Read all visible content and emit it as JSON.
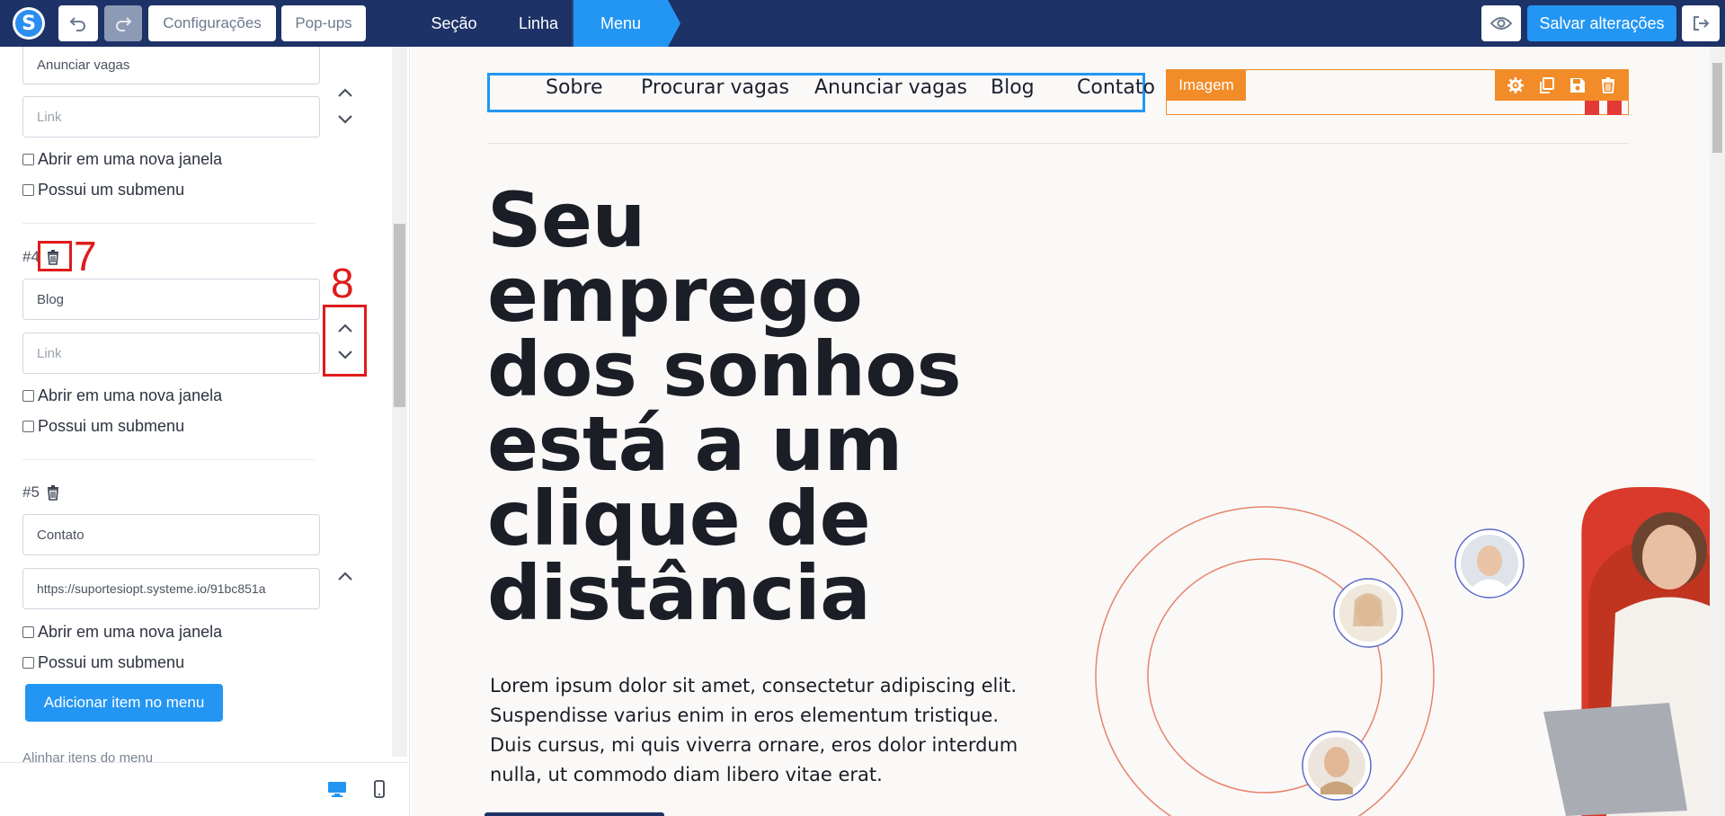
{
  "toolbar": {
    "logo_letter": "S",
    "settings_label": "Configurações",
    "popups_label": "Pop-ups",
    "tabs": [
      {
        "label": "Seção"
      },
      {
        "label": "Linha"
      },
      {
        "label": "Menu"
      }
    ],
    "save_label": "Salvar alterações"
  },
  "sidebar": {
    "item3": {
      "name_value": "Anunciar vagas",
      "link_placeholder": "Link",
      "new_window_label": "Abrir em uma nova janela",
      "submenu_label": "Possui um submenu"
    },
    "item4": {
      "number": "#4",
      "name_value": "Blog",
      "link_placeholder": "Link",
      "new_window_label": "Abrir em uma nova janela",
      "submenu_label": "Possui um submenu"
    },
    "item5": {
      "number": "#5",
      "name_value": "Contato",
      "link_value": "https://suportesiopt.systeme.io/91bc851a",
      "new_window_label": "Abrir em uma nova janela",
      "submenu_label": "Possui um submenu"
    },
    "add_item_label": "Adicionar item no menu",
    "align_label": "Alinhar itens do menu"
  },
  "annotations": {
    "label_7": "7",
    "label_8": "8",
    "color": "#e01b1b"
  },
  "preview": {
    "nav_links": [
      "Sobre",
      "Procurar vagas",
      "Anunciar vagas",
      "Blog",
      "Contato"
    ],
    "image_tag": "Imagem",
    "hero_lines": [
      "Seu emprego",
      "dos sonhos",
      "está a um",
      "clique de",
      "distância"
    ],
    "lorem_lines": [
      "Lorem ipsum dolor sit amet, consectetur adipiscing elit.",
      "Suspendisse varius enim in eros elementum tristique.",
      "Duis cursus, mi quis viverra ornare, eros dolor interdum",
      "nulla, ut commodo diam libero vitae erat."
    ]
  },
  "colors": {
    "topbar": "#1d3267",
    "accent": "#2396f3",
    "orange": "#f28c28"
  }
}
